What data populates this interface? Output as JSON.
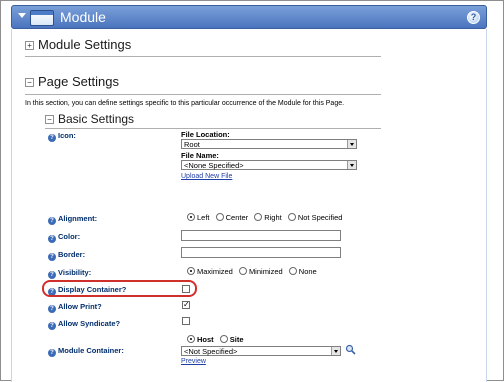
{
  "module": {
    "title": "Module",
    "icons": {
      "menu": "menu-arrow-icon",
      "window": "window-icon",
      "help": "help-icon"
    }
  },
  "sections": {
    "module_settings": "Module Settings",
    "page_settings": "Page Settings",
    "page_settings_desc": "In this section, you can define settings specific to this particular occurrence of the Module for this Page.",
    "basic_settings": "Basic Settings"
  },
  "fields": {
    "icon": {
      "label": "Icon:",
      "file_location_label": "File Location:",
      "file_location_value": "Root",
      "file_name_label": "File Name:",
      "file_name_value": "<None Specified>",
      "upload_link": "Upload New File"
    },
    "alignment": {
      "label": "Alignment:",
      "options": [
        {
          "label": "Left",
          "selected": true
        },
        {
          "label": "Center",
          "selected": false
        },
        {
          "label": "Right",
          "selected": false
        },
        {
          "label": "Not Specified",
          "selected": false
        }
      ]
    },
    "color": {
      "label": "Color:",
      "value": ""
    },
    "border": {
      "label": "Border:",
      "value": ""
    },
    "visibility": {
      "label": "Visibility:",
      "options": [
        {
          "label": "Maximized",
          "selected": true
        },
        {
          "label": "Minimized",
          "selected": false
        },
        {
          "label": "None",
          "selected": false
        }
      ]
    },
    "display_container": {
      "label": "Display Container?",
      "checked": false,
      "mark": ""
    },
    "allow_print": {
      "label": "Allow Print?",
      "checked": true,
      "mark": "✓"
    },
    "allow_syndicate": {
      "label": "Allow Syndicate?",
      "checked": false,
      "mark": ""
    },
    "module_container": {
      "label": "Module Container:",
      "options": [
        {
          "label": "Host",
          "selected": true
        },
        {
          "label": "Site",
          "selected": false
        }
      ],
      "select_value": "<Not Specified>",
      "preview_link": "Preview"
    }
  },
  "colors": {
    "title_bar": "#4b74bf",
    "label_text": "#002e6e",
    "link": "#1f3fa8",
    "highlight_ring": "#d0302b"
  }
}
